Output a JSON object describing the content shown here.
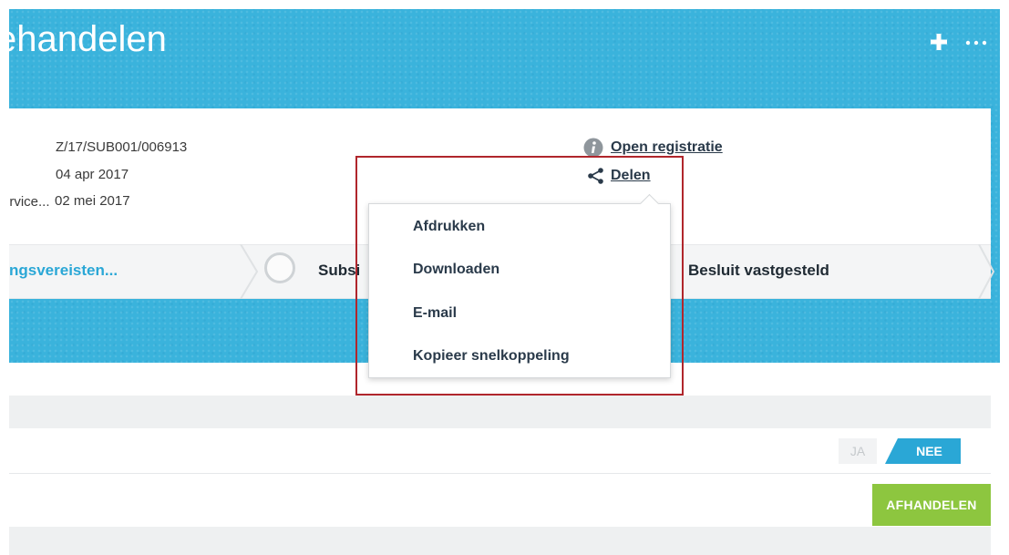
{
  "header": {
    "title": "ehandelen"
  },
  "details": {
    "case_number": "Z/17/SUB001/006913",
    "date_1": "04 apr 2017",
    "label_3": "Service...",
    "date_2": "02 mei 2017"
  },
  "actions": {
    "open_registration": "Open registratie",
    "share": "Delen"
  },
  "steps": {
    "step_1": "ngsvereisten...",
    "step_2": "Subsi",
    "step_3": "Besluit vastgesteld"
  },
  "share_menu": {
    "items": [
      "Afdrukken",
      "Downloaden",
      "E-mail",
      "Kopieer snelkoppeling"
    ]
  },
  "toggle": {
    "ja": "JA",
    "nee": "NEE",
    "selected": "NEE"
  },
  "buttons": {
    "afhandelen": "AFHANDELEN"
  },
  "colors": {
    "banner": "#3ab3dc",
    "accent_blue": "#2aa7d6",
    "green": "#8dc63f",
    "highlight_red": "#b0262c"
  }
}
